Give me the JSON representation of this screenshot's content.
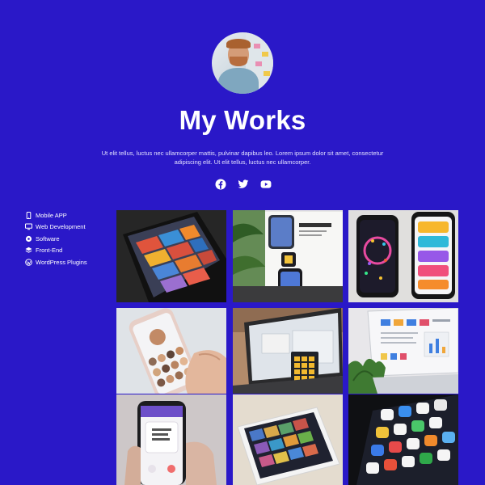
{
  "header": {
    "title": "My Works",
    "description": "Ut elit tellus, luctus nec ullamcorper mattis, pulvinar dapibus leo. Lorem ipsum dolor sit amet, consectetur adipiscing elit. Ut elit tellus, luctus nec ullamcorper."
  },
  "socials": [
    {
      "icon": "facebook-icon"
    },
    {
      "icon": "twitter-icon"
    },
    {
      "icon": "youtube-icon"
    }
  ],
  "categories": [
    {
      "label": "Mobile APP",
      "icon": "mobile-icon"
    },
    {
      "label": "Web Development",
      "icon": "monitor-icon"
    },
    {
      "label": "Software",
      "icon": "gear-icon"
    },
    {
      "label": "Front-End",
      "icon": "layers-icon"
    },
    {
      "label": "WordPress Plugins",
      "icon": "wordpress-icon"
    }
  ],
  "theme": {
    "background": "#2a18c8",
    "text": "#ffffff"
  }
}
